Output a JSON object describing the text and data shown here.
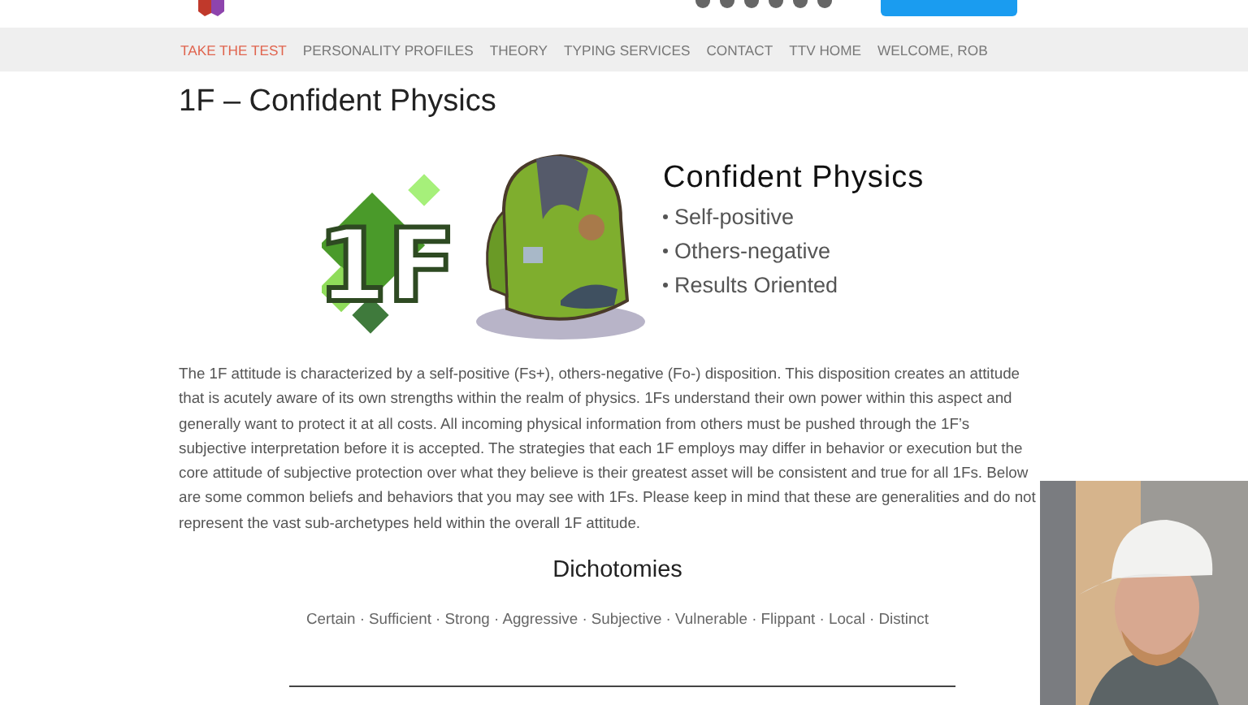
{
  "header": {
    "social_icons": [
      {
        "kind": "circle"
      },
      {
        "kind": "circle"
      },
      {
        "kind": "circle"
      },
      {
        "kind": "circle"
      },
      {
        "kind": "circle"
      },
      {
        "kind": "circle"
      }
    ]
  },
  "nav": [
    {
      "label": "TAKE THE TEST",
      "selected": true
    },
    {
      "label": "PERSONALITY PROFILES",
      "selected": false
    },
    {
      "label": "THEORY",
      "selected": false
    },
    {
      "label": "TYPING SERVICES",
      "selected": false
    },
    {
      "label": "CONTACT",
      "selected": false
    },
    {
      "label": "TTV HOME",
      "selected": false
    },
    {
      "label": "WELCOME, ROB",
      "selected": false
    }
  ],
  "title": "1F – Confident Physics",
  "hero": {
    "badge": "1F",
    "heading": "Confident Physics",
    "bullets": [
      "Self-positive",
      "Others-negative",
      "Results Oriented"
    ]
  },
  "paragraph": "The 1F attitude is characterized by a self-positive (Fs+), others-negative (Fo-) disposition. This disposition creates an attitude that is acutely aware of its own strengths within the realm of physics. 1Fs understand their own power within this aspect and generally want to protect it at all costs. All incoming physical information from others must be pushed through the 1F’s subjective interpretation before it is accepted. The strategies that each 1F employs may differ in behavior or execution but the core attitude of subjective protection over what they believe is their greatest asset will be consistent and true for all 1Fs. Below are some common beliefs and behaviors that you may see with 1Fs. Please keep in mind that these are generalities and do not represent the vast sub-archetypes held within the overall 1F attitude.",
  "dichotomies": {
    "heading": "Dichotomies",
    "items": "Certain · Sufficient · Strong · Aggressive · Subjective · Vulnerable · Flippant · Local · Distinct"
  }
}
